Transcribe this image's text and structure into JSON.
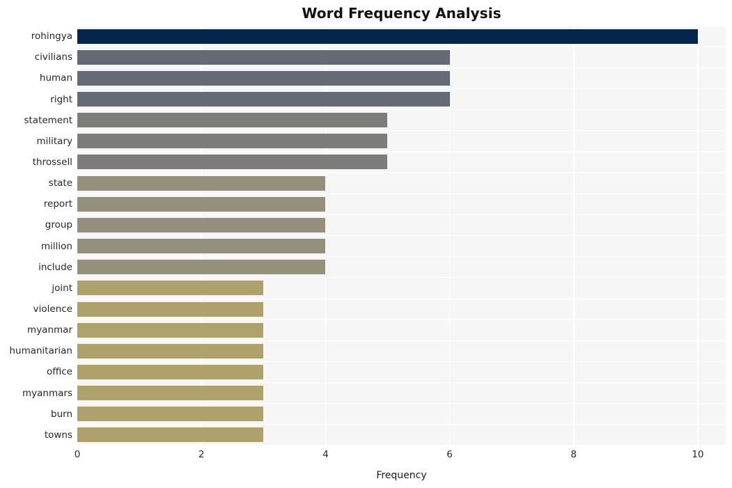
{
  "chart_data": {
    "type": "bar",
    "orientation": "horizontal",
    "title": "Word Frequency Analysis",
    "xlabel": "Frequency",
    "ylabel": "",
    "xlim": [
      0,
      10.45
    ],
    "xticks": [
      0,
      2,
      4,
      6,
      8,
      10
    ],
    "xtick_labels": [
      "0",
      "2",
      "4",
      "6",
      "8",
      "10"
    ],
    "grid": true,
    "legend": null,
    "categories": [
      "rohingya",
      "civilians",
      "human",
      "right",
      "statement",
      "military",
      "throssell",
      "state",
      "report",
      "group",
      "million",
      "include",
      "joint",
      "violence",
      "myanmar",
      "humanitarian",
      "office",
      "myanmars",
      "burn",
      "towns"
    ],
    "values": [
      10,
      6,
      6,
      6,
      5,
      5,
      5,
      4,
      4,
      4,
      4,
      4,
      3,
      3,
      3,
      3,
      3,
      3,
      3,
      3
    ],
    "bar_colors": [
      "#06254d",
      "#666a75",
      "#666a75",
      "#666a75",
      "#7d7c79",
      "#7d7c79",
      "#7d7c79",
      "#94907c",
      "#94907c",
      "#94907c",
      "#94907c",
      "#94907c",
      "#aea16c",
      "#aea16c",
      "#aea16c",
      "#aea16c",
      "#aea16c",
      "#aea16c",
      "#aea16c",
      "#aea16c"
    ],
    "plot_background": "#f6f6f7",
    "figure_background": "#ffffff",
    "gridline_color": "#ffffff",
    "tick_label_color": "#262626"
  }
}
